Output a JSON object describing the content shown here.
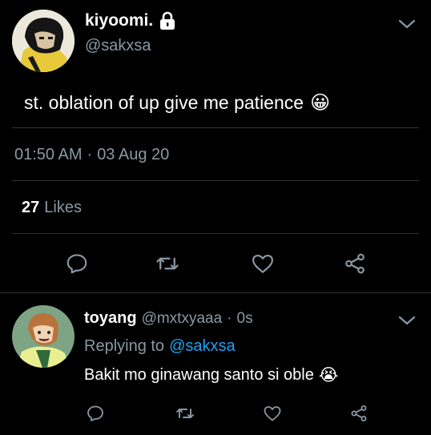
{
  "main_tweet": {
    "display_name": "kiyoomi.",
    "handle": "@sakxsa",
    "text": "st. oblation of up give me patience",
    "emoji": "😀",
    "time": "01:50 AM",
    "separator": "·",
    "date": "03 Aug 20",
    "likes_count": "27",
    "likes_label": "Likes",
    "icons": [
      "reply-icon",
      "retweet-icon",
      "like-icon",
      "share-icon"
    ]
  },
  "reply_tweet": {
    "display_name": "toyang",
    "handle": "@mxtxyaaa",
    "separator": "·",
    "age": "0s",
    "replying_prefix": "Replying to",
    "replying_to": "@sakxsa",
    "text": "Bakit mo ginawang santo si oble",
    "emoji": "😭",
    "icons": [
      "reply-icon",
      "retweet-icon",
      "like-icon",
      "share-icon"
    ]
  },
  "colors": {
    "background": "#000000",
    "text": "#ffffff",
    "muted": "#8b98a5",
    "link": "#1da1f2",
    "divider": "#2f3336"
  }
}
